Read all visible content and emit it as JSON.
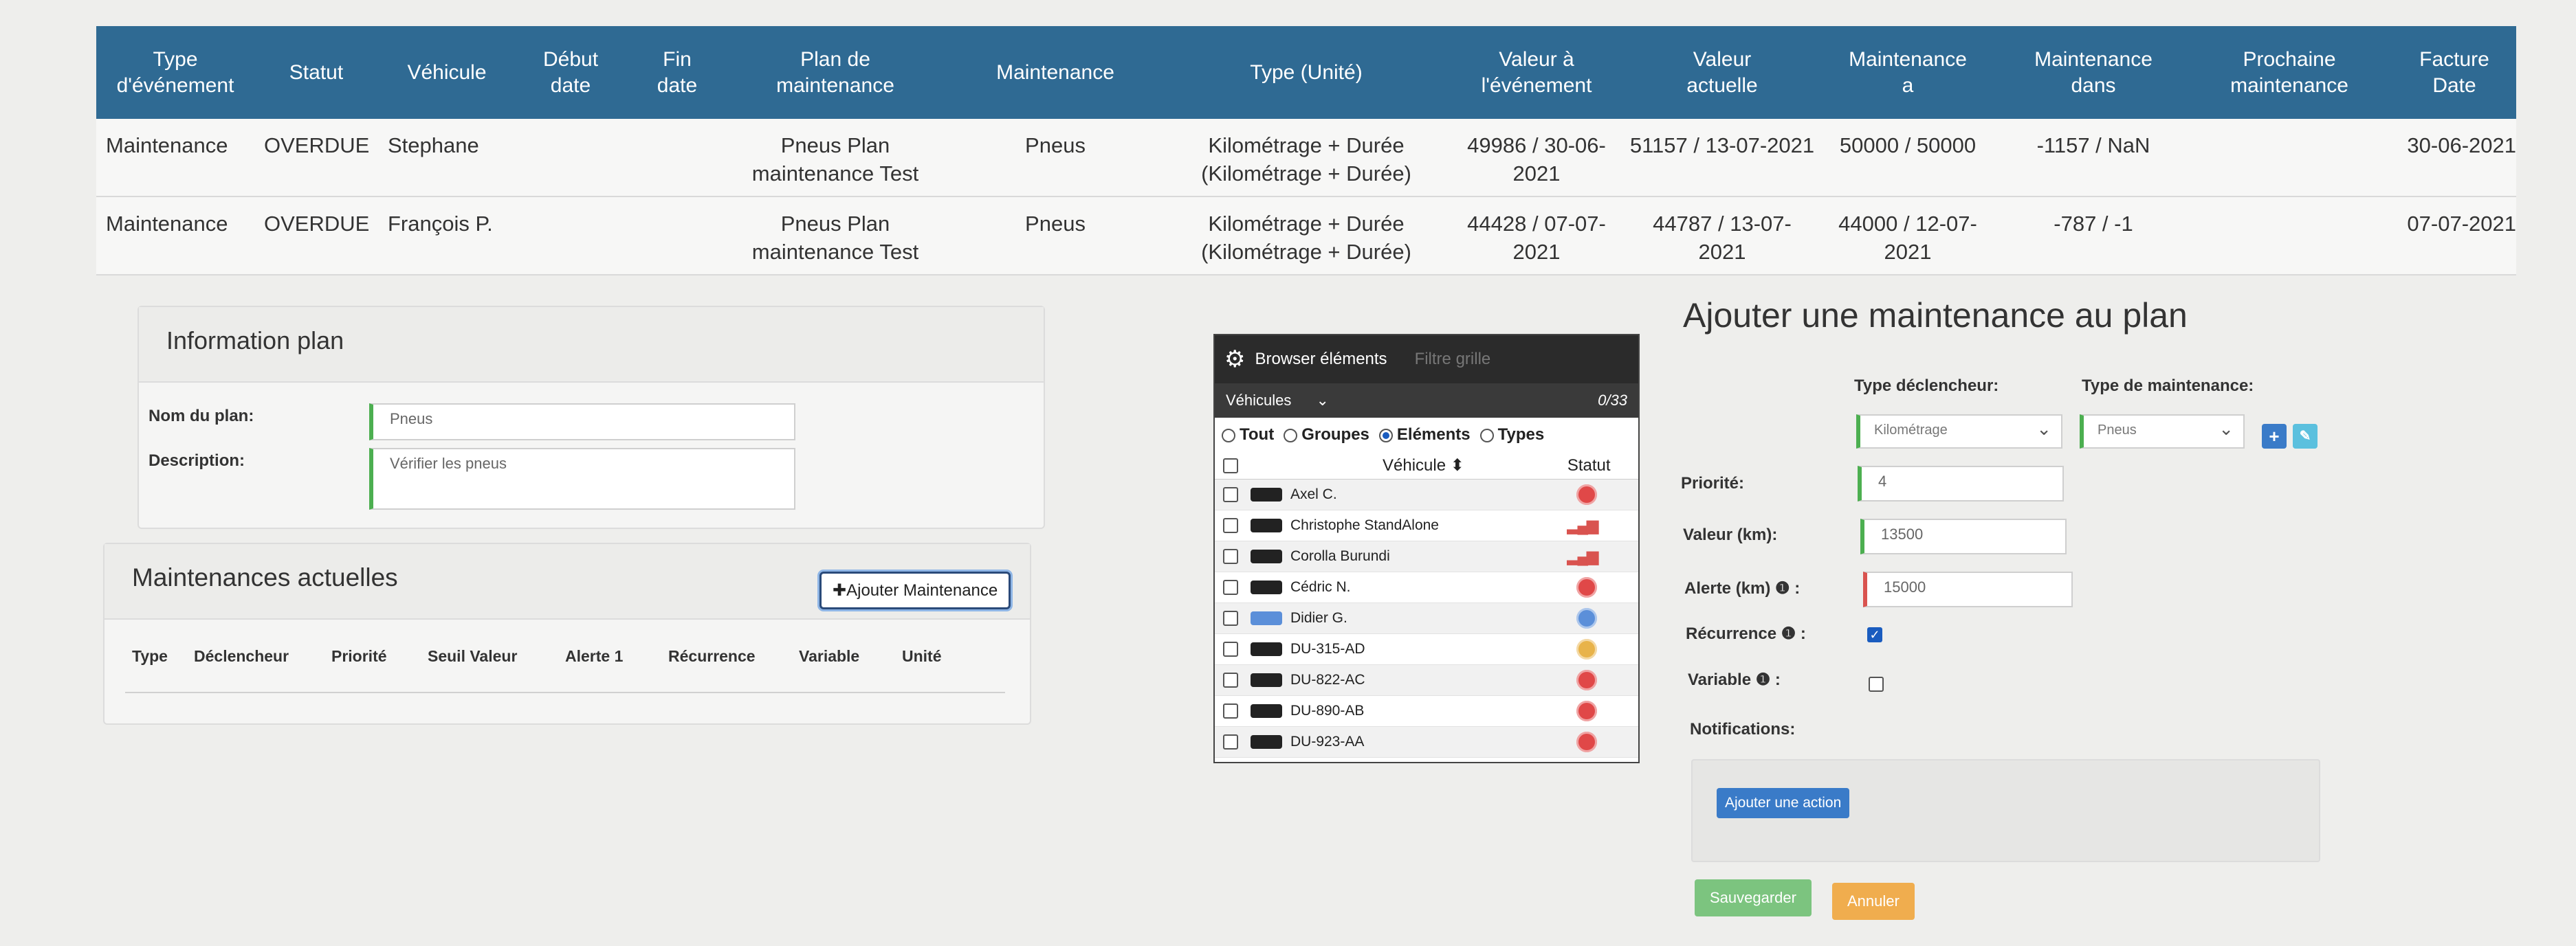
{
  "events_table": {
    "headers": [
      "Type\nd'événement",
      "Statut",
      "Véhicule",
      "Début\ndate",
      "Fin\ndate",
      "Plan de\nmaintenance",
      "Maintenance",
      "Type (Unité)",
      "Valeur à\nl'événement",
      "Valeur\nactuelle",
      "Maintenance\na",
      "Maintenance\ndans",
      "Prochaine\nmaintenance",
      "Facture\nDate"
    ],
    "rows": [
      [
        "Maintenance",
        "OVERDUE",
        "Stephane",
        "",
        "",
        "Pneus Plan maintenance Test",
        "Pneus",
        "Kilométrage + Durée (Kilométrage + Durée)",
        "49986 / 30-06-2021",
        "51157 / 13-07-2021",
        "50000 / 50000",
        "-1157 / NaN",
        "",
        "30-06-2021"
      ],
      [
        "Maintenance",
        "OVERDUE",
        "François P.",
        "",
        "",
        "Pneus Plan maintenance Test",
        "Pneus",
        "Kilométrage + Durée (Kilométrage + Durée)",
        "44428 / 07-07-2021",
        "44787 / 13-07-2021",
        "44000 / 12-07-2021",
        "-787 / -1",
        "",
        "07-07-2021"
      ]
    ]
  },
  "info_plan": {
    "title": "Information plan",
    "name_label": "Nom du plan:",
    "name_value": "Pneus",
    "desc_label": "Description:",
    "desc_value": "Vérifier les pneus"
  },
  "current_maint": {
    "title": "Maintenances actuelles",
    "add_button": "✚Ajouter Maintenance",
    "columns": [
      "Type",
      "Déclencheur",
      "Priorité",
      "Seuil Valeur",
      "Alerte 1",
      "Récurrence",
      "Variable",
      "Unité"
    ]
  },
  "browser": {
    "title": "Browser éléments",
    "filter_placeholder": "Filtre grille",
    "group": "Véhicules",
    "count": "0/33",
    "radios": [
      "Tout",
      "Groupes",
      "Eléments",
      "Types"
    ],
    "col_vehicle": "Véhicule ⬍",
    "col_status": "Statut",
    "rows": [
      {
        "name": "Axel C.",
        "status": "red"
      },
      {
        "name": "Christophe StandAlone",
        "status": "signal"
      },
      {
        "name": "Corolla Burundi",
        "status": "signal"
      },
      {
        "name": "Cédric N.",
        "status": "red"
      },
      {
        "name": "Didier G.",
        "status": "blue"
      },
      {
        "name": "DU-315-AD",
        "status": "yellow"
      },
      {
        "name": "DU-822-AC",
        "status": "red"
      },
      {
        "name": "DU-890-AB",
        "status": "red"
      },
      {
        "name": "DU-923-AA",
        "status": "red"
      }
    ]
  },
  "add_form": {
    "title": "Ajouter une maintenance au plan",
    "trigger_type_label": "Type déclencheur:",
    "maint_type_label": "Type de maintenance:",
    "trigger_type_value": "Kilométrage",
    "maint_type_value": "Pneus",
    "priority_label": "Priorité:",
    "priority_value": "4",
    "value_label": "Valeur (km):",
    "value_value": "13500",
    "alert_label": "Alerte (km) ❶ :",
    "alert_value": "15000",
    "recurrence_label": "Récurrence ❶ :",
    "variable_label": "Variable ❶ :",
    "notifications_label": "Notifications:",
    "add_action": "Ajouter une action",
    "save": "Sauvegarder",
    "cancel": "Annuler"
  },
  "colors": {
    "header_blue": "#2f6a93",
    "save_green": "#7cc47f",
    "cancel_orange": "#f0ad4e",
    "status_red": "#e04848",
    "status_blue": "#5b8fd9",
    "status_yellow": "#e8b34a"
  }
}
